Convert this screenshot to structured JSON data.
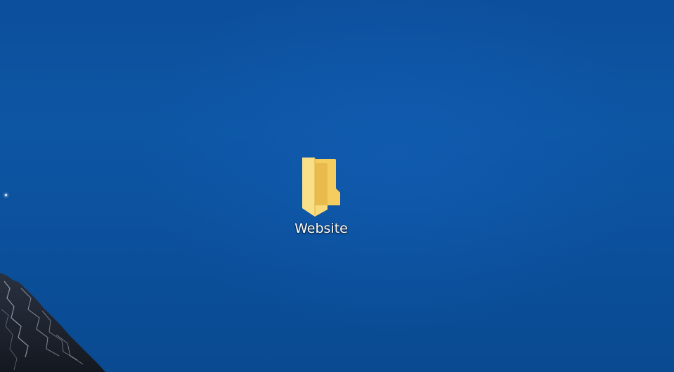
{
  "desktop": {
    "icons": [
      {
        "label": "Website",
        "icon": "folder-icon"
      }
    ]
  },
  "colors": {
    "wallpaper_sky": "#0d56a4",
    "folder_front": "#f7d774",
    "folder_back": "#e8b94a"
  }
}
